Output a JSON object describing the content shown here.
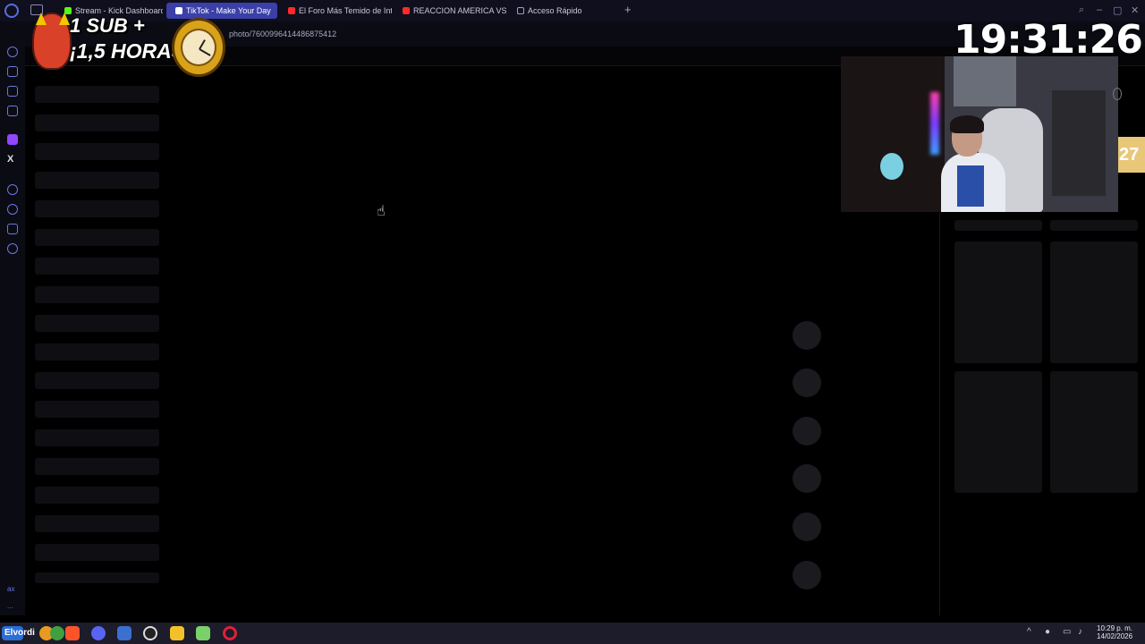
{
  "browser": {
    "tabs": [
      {
        "label": "Stream - Kick Dashboard",
        "icon": "kick-icon",
        "color": "#53fc18",
        "active": false
      },
      {
        "label": "TikTok - Make Your Day",
        "icon": "tiktok-icon",
        "color": "#ffffff",
        "active": true
      },
      {
        "label": "El Foro Más Temido de Int",
        "icon": "youtube-icon",
        "color": "#ff2b2b",
        "active": false
      },
      {
        "label": "REACCION AMERICA VS C",
        "icon": "youtube-icon",
        "color": "#ff2b2b",
        "active": false
      },
      {
        "label": "Acceso Rápido",
        "icon": "grid-icon",
        "color": "#9aa0c8",
        "active": false
      }
    ],
    "new_tab": "+",
    "url": "photo/7600996414486875412"
  },
  "sidebar": {
    "items": [
      "messenger-icon",
      "store-icon",
      "tiktok-icon",
      "mail-icon",
      "twitch-icon",
      "x-icon",
      "play-icon",
      "history-icon",
      "extensions-icon",
      "settings-icon",
      "ai-icon",
      "more-icon"
    ],
    "x_label": "X",
    "bottom_label": "ax",
    "more_label": "..."
  },
  "overlay": {
    "sub_line1": "1 SUB +",
    "sub_line2": "¡1,5 HORAS!",
    "timer": "19:31:26",
    "side_badge": "27"
  },
  "taskbar": {
    "start_label": "Elvordi",
    "apps": [
      "widgets-icon",
      "brave-icon",
      "discord-icon",
      "store-icon",
      "obs-icon",
      "explorer-icon",
      "game-icon",
      "opera-icon"
    ],
    "tray_chevron": "^",
    "time": "10:29 p. m.",
    "date": "14/02/2026"
  },
  "colors": {
    "accent": "#3b3fa8",
    "background": "#000000",
    "skeleton": "#0f0f13"
  }
}
